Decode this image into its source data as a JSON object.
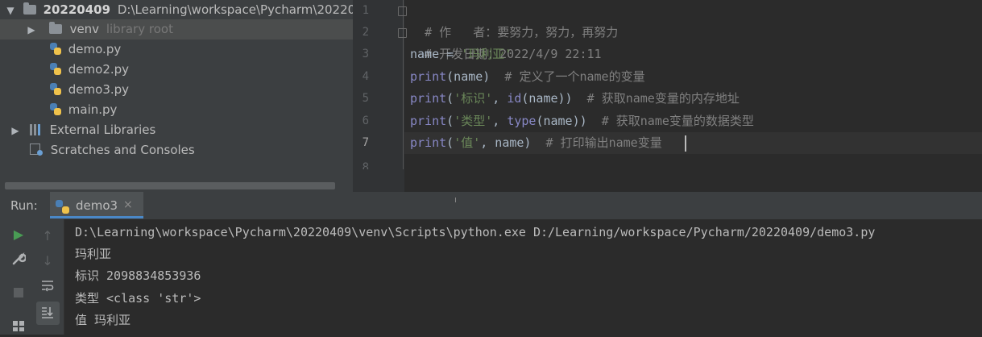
{
  "project_tree": {
    "root": {
      "name": "20220409",
      "path": "D:\\Learning\\workspace\\Pycharm\\20220409"
    },
    "venv": {
      "name": "venv",
      "hint": "library root"
    },
    "files": [
      "demo.py",
      "demo2.py",
      "demo3.py",
      "main.py"
    ],
    "external_libraries": "External Libraries",
    "scratches": "Scratches and Consoles"
  },
  "editor": {
    "line_numbers": [
      "1",
      "2",
      "3",
      "4",
      "5",
      "6",
      "7",
      "8"
    ],
    "current_line": "7",
    "lines": {
      "l1": {
        "comment": "# 作   者：要努力，努力，再努力"
      },
      "l2": {
        "comment": "# 开发日期：2022/4/9 22:11"
      },
      "l3": {
        "var": "name = ",
        "str": "'玛利亚'"
      },
      "l4": {
        "fn": "print",
        "args": "(name)  ",
        "comment": "# 定义了一个name的变量"
      },
      "l5": {
        "fn": "print",
        "p1": "(",
        "str": "'标识'",
        "p2": ", ",
        "fn2": "id",
        "p3": "(name))  ",
        "comment": "# 获取name变量的内存地址"
      },
      "l6": {
        "fn": "print",
        "p1": "(",
        "str": "'类型'",
        "p2": ", ",
        "fn2": "type",
        "p3": "(name))  ",
        "comment": "# 获取name变量的数据类型"
      },
      "l7": {
        "fn": "print",
        "p1": "(",
        "str": "'值'",
        "p2": ", name)  ",
        "comment": "# 打印输出name变量"
      }
    }
  },
  "run_panel": {
    "label": "Run:",
    "tab": "demo3",
    "close": "×",
    "output": [
      "D:\\Learning\\workspace\\Pycharm\\20220409\\venv\\Scripts\\python.exe D:/Learning/workspace/Pycharm/20220409/demo3.py",
      "玛利亚",
      "标识 2098834853936",
      "类型 <class 'str'>",
      "值 玛利亚"
    ]
  },
  "colors": {
    "accent": "#4a88c7",
    "run_green": "#499c54",
    "string": "#6a8759",
    "builtin": "#8888c6",
    "comment": "#808080"
  },
  "icons": [
    "folder-icon",
    "python-file-icon",
    "libraries-icon",
    "scratches-icon",
    "run-icon",
    "wrench-icon",
    "stop-icon",
    "up-arrow-icon",
    "down-arrow-icon",
    "soft-wrap-icon",
    "scroll-to-end-icon",
    "layout-icon"
  ]
}
